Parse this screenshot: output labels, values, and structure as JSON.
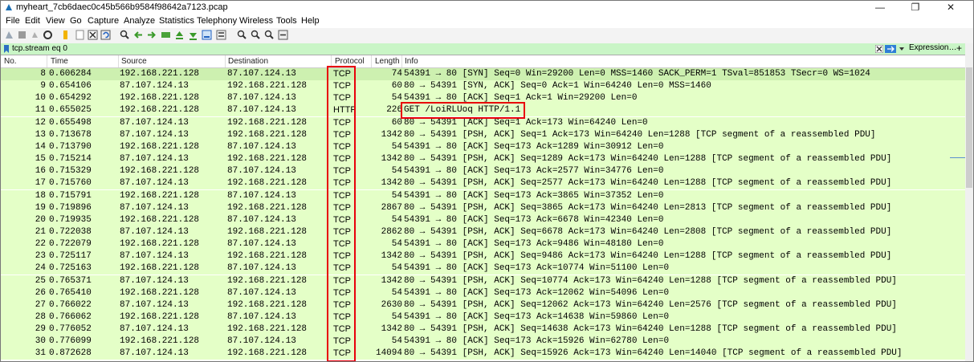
{
  "window": {
    "title": "myheart_7cb6daec0c45b566b9584f98642a7123.pcap",
    "controls": [
      "—",
      "❐",
      "✕"
    ]
  },
  "menu": [
    "File",
    "Edit",
    "View",
    "Go",
    "Capture",
    "Analyze",
    "Statistics",
    "Telephony",
    "Wireless",
    "Tools",
    "Help"
  ],
  "toolbar": {
    "icons": [
      "shark-fin-start-icon",
      "stop-icon",
      "restart-icon",
      "options-icon",
      "open-icon",
      "file-icon",
      "close-file-icon",
      "reload-icon",
      "find-icon",
      "back-icon",
      "forward-icon",
      "goto-icon",
      "first-icon",
      "last-icon",
      "autoscroll-icon",
      "colorize-icon",
      "zoom-in-icon",
      "zoom-out-icon",
      "zoom-normal-icon",
      "resize-columns-icon"
    ]
  },
  "filter": {
    "value": "tcp.stream eq 0",
    "expression_label": "Expression…"
  },
  "columns": [
    "No.",
    "Time",
    "Source",
    "Destination",
    "Protocol",
    "Length",
    "Info"
  ],
  "packets": [
    {
      "no": "8",
      "time": "0.606284",
      "src": "192.168.221.128",
      "dst": "87.107.124.13",
      "proto": "TCP",
      "len": "74",
      "info": "54391 → 80 [SYN] Seq=0 Win=29200 Len=0 MSS=1460 SACK_PERM=1 TSval=851853 TSecr=0 WS=1024"
    },
    {
      "no": "9",
      "time": "0.654106",
      "src": "87.107.124.13",
      "dst": "192.168.221.128",
      "proto": "TCP",
      "len": "60",
      "info": "80 → 54391 [SYN, ACK] Seq=0 Ack=1 Win=64240 Len=0 MSS=1460"
    },
    {
      "no": "10",
      "time": "0.654292",
      "src": "192.168.221.128",
      "dst": "87.107.124.13",
      "proto": "TCP",
      "len": "54",
      "info": "54391 → 80 [ACK] Seq=1 Ack=1 Win=29200 Len=0"
    },
    {
      "no": "11",
      "time": "0.655025",
      "src": "192.168.221.128",
      "dst": "87.107.124.13",
      "proto": "HTTP",
      "len": "226",
      "info": "GET /LoiRLUoq HTTP/1.1"
    },
    {
      "no": "12",
      "time": "0.655498",
      "src": "87.107.124.13",
      "dst": "192.168.221.128",
      "proto": "TCP",
      "len": "60",
      "info": "80 → 54391 [ACK] Seq=1 Ack=173 Win=64240 Len=0"
    },
    {
      "no": "13",
      "time": "0.713678",
      "src": "87.107.124.13",
      "dst": "192.168.221.128",
      "proto": "TCP",
      "len": "1342",
      "info": "80 → 54391 [PSH, ACK] Seq=1 Ack=173 Win=64240 Len=1288 [TCP segment of a reassembled PDU]"
    },
    {
      "no": "14",
      "time": "0.713790",
      "src": "192.168.221.128",
      "dst": "87.107.124.13",
      "proto": "TCP",
      "len": "54",
      "info": "54391 → 80 [ACK] Seq=173 Ack=1289 Win=30912 Len=0"
    },
    {
      "no": "15",
      "time": "0.715214",
      "src": "87.107.124.13",
      "dst": "192.168.221.128",
      "proto": "TCP",
      "len": "1342",
      "info": "80 → 54391 [PSH, ACK] Seq=1289 Ack=173 Win=64240 Len=1288 [TCP segment of a reassembled PDU]"
    },
    {
      "no": "16",
      "time": "0.715329",
      "src": "192.168.221.128",
      "dst": "87.107.124.13",
      "proto": "TCP",
      "len": "54",
      "info": "54391 → 80 [ACK] Seq=173 Ack=2577 Win=34776 Len=0"
    },
    {
      "no": "17",
      "time": "0.715760",
      "src": "87.107.124.13",
      "dst": "192.168.221.128",
      "proto": "TCP",
      "len": "1342",
      "info": "80 → 54391 [PSH, ACK] Seq=2577 Ack=173 Win=64240 Len=1288 [TCP segment of a reassembled PDU]"
    },
    {
      "no": "18",
      "time": "0.715791",
      "src": "192.168.221.128",
      "dst": "87.107.124.13",
      "proto": "TCP",
      "len": "54",
      "info": "54391 → 80 [ACK] Seq=173 Ack=3865 Win=37352 Len=0"
    },
    {
      "no": "19",
      "time": "0.719896",
      "src": "87.107.124.13",
      "dst": "192.168.221.128",
      "proto": "TCP",
      "len": "2867",
      "info": "80 → 54391 [PSH, ACK] Seq=3865 Ack=173 Win=64240 Len=2813 [TCP segment of a reassembled PDU]"
    },
    {
      "no": "20",
      "time": "0.719935",
      "src": "192.168.221.128",
      "dst": "87.107.124.13",
      "proto": "TCP",
      "len": "54",
      "info": "54391 → 80 [ACK] Seq=173 Ack=6678 Win=42340 Len=0"
    },
    {
      "no": "21",
      "time": "0.722038",
      "src": "87.107.124.13",
      "dst": "192.168.221.128",
      "proto": "TCP",
      "len": "2862",
      "info": "80 → 54391 [PSH, ACK] Seq=6678 Ack=173 Win=64240 Len=2808 [TCP segment of a reassembled PDU]"
    },
    {
      "no": "22",
      "time": "0.722079",
      "src": "192.168.221.128",
      "dst": "87.107.124.13",
      "proto": "TCP",
      "len": "54",
      "info": "54391 → 80 [ACK] Seq=173 Ack=9486 Win=48180 Len=0"
    },
    {
      "no": "23",
      "time": "0.725117",
      "src": "87.107.124.13",
      "dst": "192.168.221.128",
      "proto": "TCP",
      "len": "1342",
      "info": "80 → 54391 [PSH, ACK] Seq=9486 Ack=173 Win=64240 Len=1288 [TCP segment of a reassembled PDU]"
    },
    {
      "no": "24",
      "time": "0.725163",
      "src": "192.168.221.128",
      "dst": "87.107.124.13",
      "proto": "TCP",
      "len": "54",
      "info": "54391 → 80 [ACK] Seq=173 Ack=10774 Win=51100 Len=0"
    },
    {
      "no": "25",
      "time": "0.765371",
      "src": "87.107.124.13",
      "dst": "192.168.221.128",
      "proto": "TCP",
      "len": "1342",
      "info": "80 → 54391 [PSH, ACK] Seq=10774 Ack=173 Win=64240 Len=1288 [TCP segment of a reassembled PDU]"
    },
    {
      "no": "26",
      "time": "0.765410",
      "src": "192.168.221.128",
      "dst": "87.107.124.13",
      "proto": "TCP",
      "len": "54",
      "info": "54391 → 80 [ACK] Seq=173 Ack=12062 Win=54096 Len=0"
    },
    {
      "no": "27",
      "time": "0.766022",
      "src": "87.107.124.13",
      "dst": "192.168.221.128",
      "proto": "TCP",
      "len": "2630",
      "info": "80 → 54391 [PSH, ACK] Seq=12062 Ack=173 Win=64240 Len=2576 [TCP segment of a reassembled PDU]"
    },
    {
      "no": "28",
      "time": "0.766062",
      "src": "192.168.221.128",
      "dst": "87.107.124.13",
      "proto": "TCP",
      "len": "54",
      "info": "54391 → 80 [ACK] Seq=173 Ack=14638 Win=59860 Len=0"
    },
    {
      "no": "29",
      "time": "0.776052",
      "src": "87.107.124.13",
      "dst": "192.168.221.128",
      "proto": "TCP",
      "len": "1342",
      "info": "80 → 54391 [PSH, ACK] Seq=14638 Ack=173 Win=64240 Len=1288 [TCP segment of a reassembled PDU]"
    },
    {
      "no": "30",
      "time": "0.776099",
      "src": "192.168.221.128",
      "dst": "87.107.124.13",
      "proto": "TCP",
      "len": "54",
      "info": "54391 → 80 [ACK] Seq=173 Ack=15926 Win=62780 Len=0"
    },
    {
      "no": "31",
      "time": "0.872628",
      "src": "87.107.124.13",
      "dst": "192.168.221.128",
      "proto": "TCP",
      "len": "14094",
      "info": "80 → 54391 [PSH, ACK] Seq=15926 Ack=173 Win=64240 Len=14040 [TCP segment of a reassembled PDU]"
    }
  ],
  "colors": {
    "row_bg": "#e4ffc7",
    "filter_bg": "#c9f5c6",
    "highlight_box": "#e8000a"
  }
}
